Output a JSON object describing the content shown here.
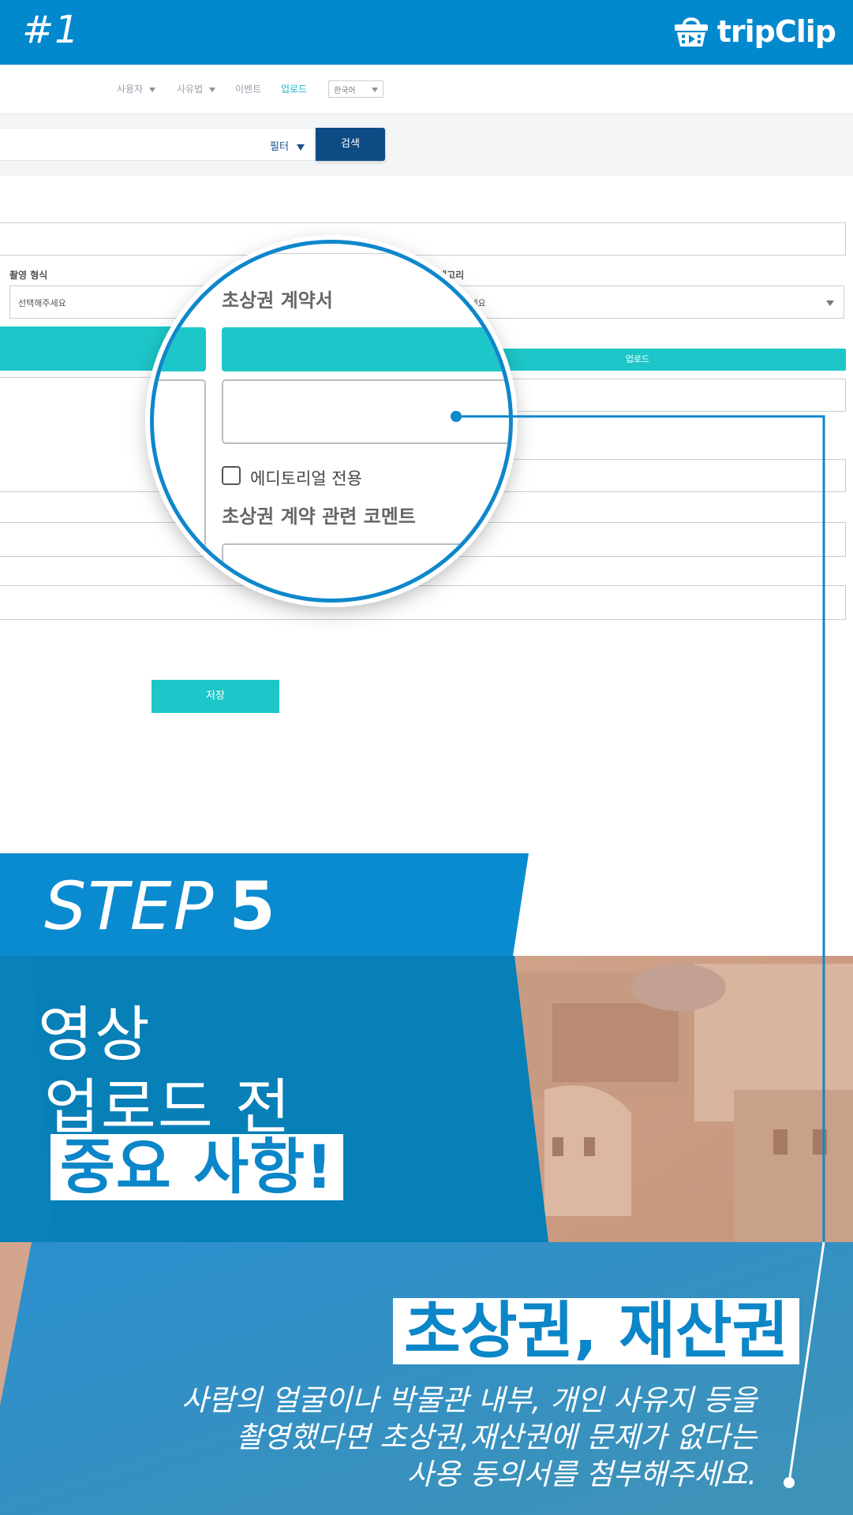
{
  "banner": {
    "tag": "#1",
    "logo_text": "tripClip",
    "logo_icon": "basket-play-icon"
  },
  "nav": {
    "items": [
      {
        "label": "사용자",
        "has_caret": true
      },
      {
        "label": "사유법",
        "has_caret": true
      },
      {
        "label": "이벤트",
        "has_caret": false
      },
      {
        "label": "업로드",
        "has_caret": false,
        "active": true
      }
    ],
    "language": "한국어"
  },
  "search": {
    "filter_label": "필터",
    "button_label": "검색"
  },
  "form": {
    "shoot_type_label": "촬영 형식",
    "shoot_type_value": "선택해주세요",
    "category_label": "카테고리",
    "category_value": "선택해주세요",
    "upload_label": "업로드",
    "save_label": "저장"
  },
  "magnifier": {
    "portrait_contract_label": "초상권 계약서",
    "editorial_label": "에디토리얼 전용",
    "portrait_comment_label": "초상권 계약 관련 코멘트"
  },
  "step": {
    "word": "STEP",
    "number": "5",
    "headline_line1": "영상",
    "headline_line2": "업로드 전",
    "headline_highlight": "중요 사항!"
  },
  "section": {
    "title": "초상권, 재산권",
    "desc_line1": "사람의 얼굴이나 박물관 내부, 개인 사유지 등을",
    "desc_line2": "촬영했다면 초상권,재산권에 문제가 없다는",
    "desc_line3": "사용 동의서를 첨부해주세요."
  },
  "colors": {
    "brand": "#0288cd",
    "teal": "#1dc6c8",
    "navy": "#0e4b84"
  }
}
